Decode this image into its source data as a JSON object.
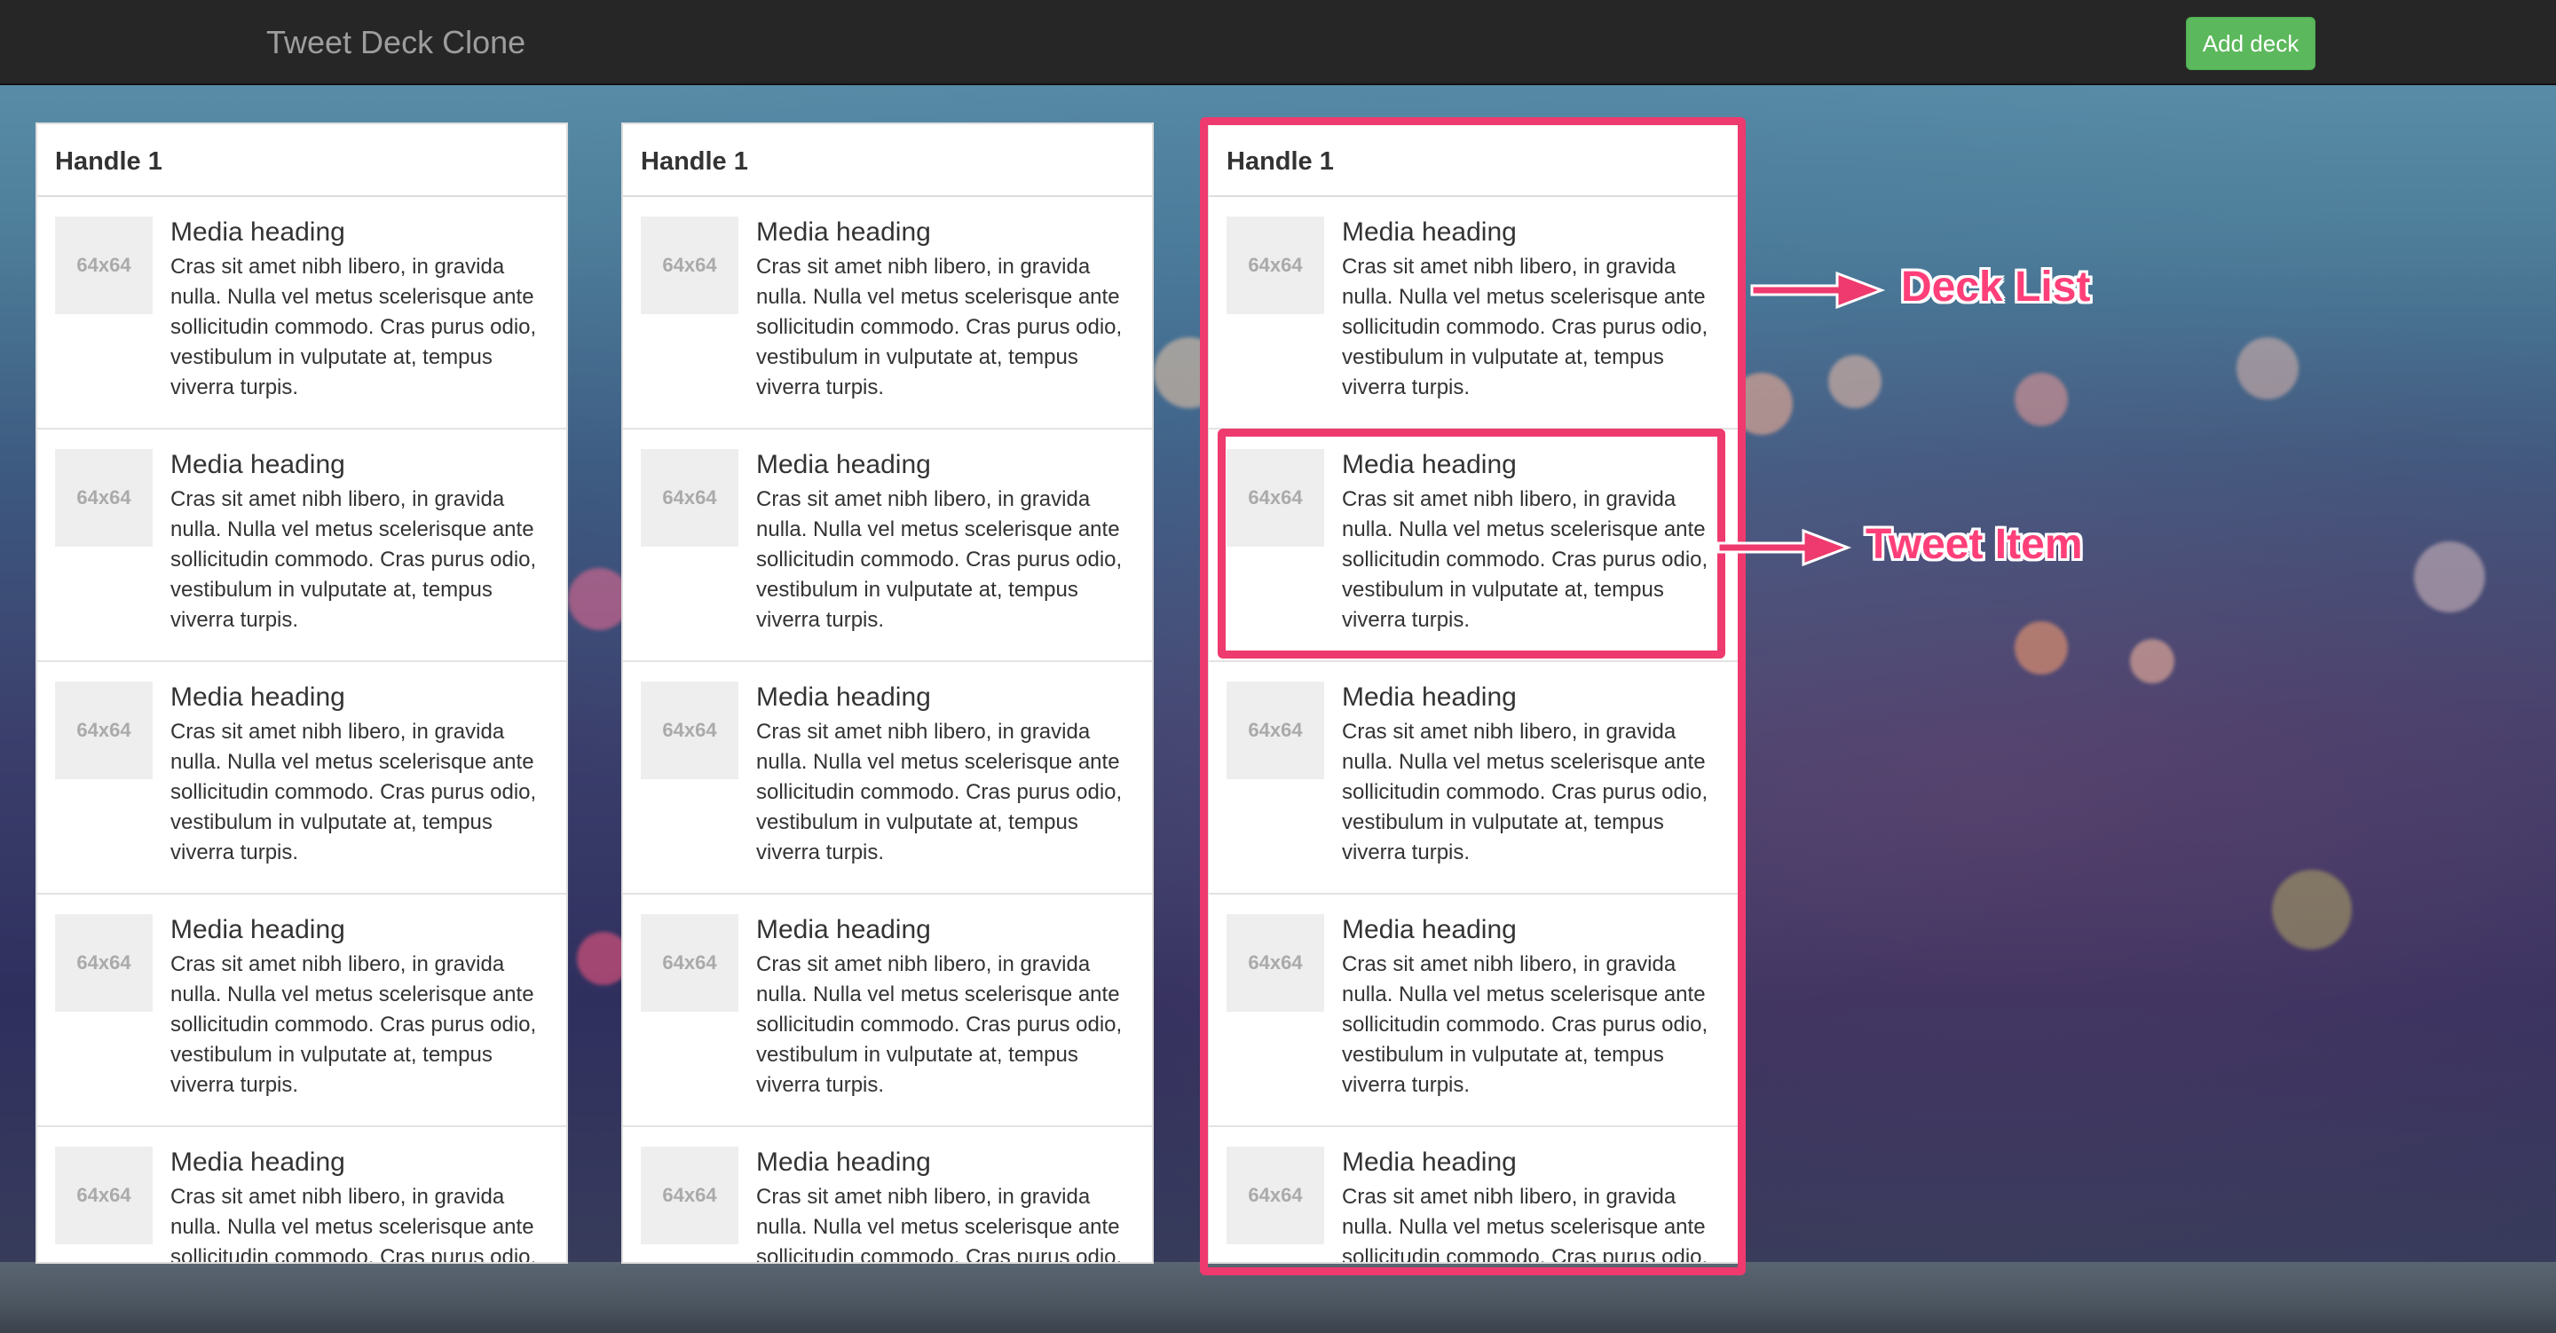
{
  "navbar": {
    "brand": "Tweet Deck Clone",
    "add_deck_label": "Add deck"
  },
  "decks": [
    {
      "handle": "Handle 1",
      "tweets": [
        {
          "thumb": "64x64",
          "heading": "Media heading",
          "body": "Cras sit amet nibh libero, in gravida nulla. Nulla vel metus scelerisque ante sollicitudin commodo. Cras purus odio, vestibulum in vulputate at, tempus viverra turpis."
        },
        {
          "thumb": "64x64",
          "heading": "Media heading",
          "body": "Cras sit amet nibh libero, in gravida nulla. Nulla vel metus scelerisque ante sollicitudin commodo. Cras purus odio, vestibulum in vulputate at, tempus viverra turpis."
        },
        {
          "thumb": "64x64",
          "heading": "Media heading",
          "body": "Cras sit amet nibh libero, in gravida nulla. Nulla vel metus scelerisque ante sollicitudin commodo. Cras purus odio, vestibulum in vulputate at, tempus viverra turpis."
        },
        {
          "thumb": "64x64",
          "heading": "Media heading",
          "body": "Cras sit amet nibh libero, in gravida nulla. Nulla vel metus scelerisque ante sollicitudin commodo. Cras purus odio, vestibulum in vulputate at, tempus viverra turpis."
        },
        {
          "thumb": "64x64",
          "heading": "Media heading",
          "body": "Cras sit amet nibh libero, in gravida nulla. Nulla vel metus scelerisque ante sollicitudin commodo. Cras purus odio, vestibulum in vulputate at, tempus viverra turpis."
        }
      ]
    },
    {
      "handle": "Handle 1",
      "tweets": [
        {
          "thumb": "64x64",
          "heading": "Media heading",
          "body": "Cras sit amet nibh libero, in gravida nulla. Nulla vel metus scelerisque ante sollicitudin commodo. Cras purus odio, vestibulum in vulputate at, tempus viverra turpis."
        },
        {
          "thumb": "64x64",
          "heading": "Media heading",
          "body": "Cras sit amet nibh libero, in gravida nulla. Nulla vel metus scelerisque ante sollicitudin commodo. Cras purus odio, vestibulum in vulputate at, tempus viverra turpis."
        },
        {
          "thumb": "64x64",
          "heading": "Media heading",
          "body": "Cras sit amet nibh libero, in gravida nulla. Nulla vel metus scelerisque ante sollicitudin commodo. Cras purus odio, vestibulum in vulputate at, tempus viverra turpis."
        },
        {
          "thumb": "64x64",
          "heading": "Media heading",
          "body": "Cras sit amet nibh libero, in gravida nulla. Nulla vel metus scelerisque ante sollicitudin commodo. Cras purus odio, vestibulum in vulputate at, tempus viverra turpis."
        },
        {
          "thumb": "64x64",
          "heading": "Media heading",
          "body": "Cras sit amet nibh libero, in gravida nulla. Nulla vel metus scelerisque ante sollicitudin commodo. Cras purus odio, vestibulum in vulputate at, tempus viverra turpis."
        }
      ]
    },
    {
      "handle": "Handle 1",
      "tweets": [
        {
          "thumb": "64x64",
          "heading": "Media heading",
          "body": "Cras sit amet nibh libero, in gravida nulla. Nulla vel metus scelerisque ante sollicitudin commodo. Cras purus odio, vestibulum in vulputate at, tempus viverra turpis."
        },
        {
          "thumb": "64x64",
          "heading": "Media heading",
          "body": "Cras sit amet nibh libero, in gravida nulla. Nulla vel metus scelerisque ante sollicitudin commodo. Cras purus odio, vestibulum in vulputate at, tempus viverra turpis."
        },
        {
          "thumb": "64x64",
          "heading": "Media heading",
          "body": "Cras sit amet nibh libero, in gravida nulla. Nulla vel metus scelerisque ante sollicitudin commodo. Cras purus odio, vestibulum in vulputate at, tempus viverra turpis."
        },
        {
          "thumb": "64x64",
          "heading": "Media heading",
          "body": "Cras sit amet nibh libero, in gravida nulla. Nulla vel metus scelerisque ante sollicitudin commodo. Cras purus odio, vestibulum in vulputate at, tempus viverra turpis."
        },
        {
          "thumb": "64x64",
          "heading": "Media heading",
          "body": "Cras sit amet nibh libero, in gravida nulla. Nulla vel metus scelerisque ante sollicitudin commodo. Cras purus odio, vestibulum in vulputate at, tempus viverra turpis."
        }
      ]
    }
  ],
  "annotations": {
    "deck_list_label": "Deck List",
    "tweet_item_label": "Tweet Item",
    "color": "#ee3a6e"
  },
  "colors": {
    "navbar_bg": "#262626",
    "brand_text": "#9d9d9d",
    "add_button": "#5cb85c"
  }
}
